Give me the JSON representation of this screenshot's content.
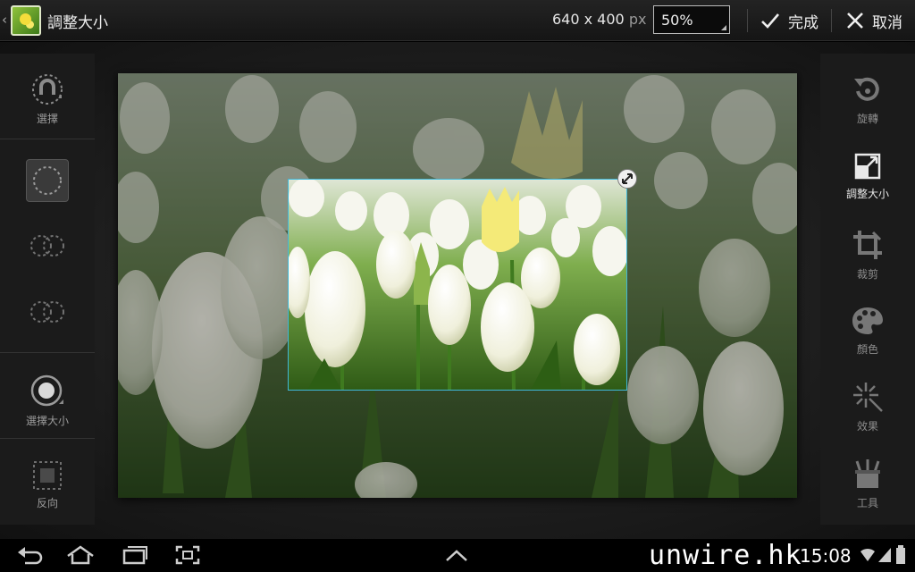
{
  "topbar": {
    "title": "調整大小",
    "dimensions": "640 x 400",
    "dimensions_unit": "px",
    "zoom_value": "50%",
    "done_label": "完成",
    "cancel_label": "取消"
  },
  "left_tools": {
    "select_label": "選擇",
    "brush_size_label": "選擇大小",
    "invert_label": "反向"
  },
  "right_tools": {
    "rotate_label": "旋轉",
    "resize_label": "調整大小",
    "crop_label": "裁剪",
    "color_label": "顏色",
    "effects_label": "效果",
    "tools_label": "工具"
  },
  "status": {
    "watermark": "unwire.hk",
    "time": "15:08"
  },
  "colors": {
    "selection_border": "#3fb7d8",
    "accent_active": "#e8e8e8"
  }
}
